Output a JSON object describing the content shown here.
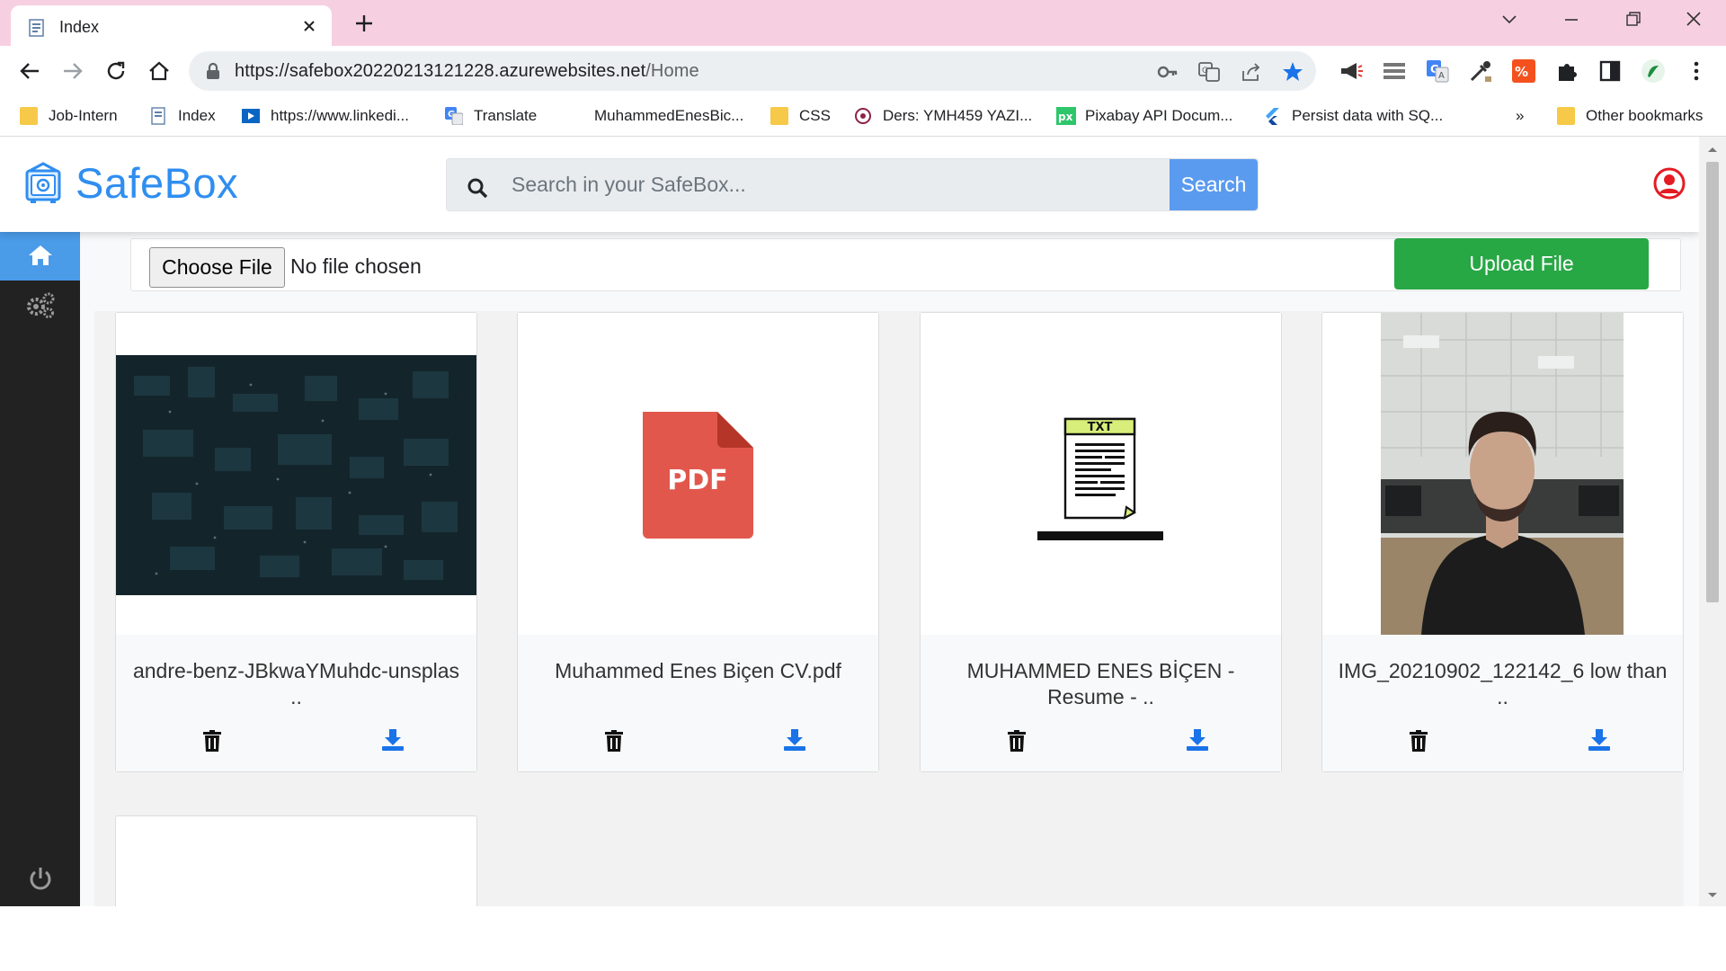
{
  "browser": {
    "tab_title": "Index",
    "url_host": "https://safebox20220213121228.azurewebsites.net",
    "url_path": "/Home",
    "bookmarks": [
      {
        "label": "Job-Intern",
        "icon": "folder-icon"
      },
      {
        "label": "Index",
        "icon": "page-icon"
      },
      {
        "label": "https://www.linkedi...",
        "icon": "linkedin-icon"
      },
      {
        "label": "Translate",
        "icon": "translate-icon"
      },
      {
        "label": "MuhammedEnesBic...",
        "icon": "github-icon"
      },
      {
        "label": "CSS",
        "icon": "folder-icon"
      },
      {
        "label": "Ders: YMH459 YAZI...",
        "icon": "course-icon"
      },
      {
        "label": "Pixabay API Docum...",
        "icon": "pixabay-icon"
      },
      {
        "label": "Persist data with SQ...",
        "icon": "flutter-icon"
      }
    ],
    "bookmarks_overflow": "»",
    "other_bookmarks": "Other bookmarks"
  },
  "app": {
    "brand": "SafeBox",
    "search_placeholder": "Search in your SafeBox...",
    "search_button": "Search",
    "choose_file": "Choose File",
    "no_file": "No file chosen",
    "upload_button": "Upload File",
    "files": [
      {
        "name": "andre-benz-JBkwaYMuhdc-unsplas ..",
        "thumb": "city-photo"
      },
      {
        "name": "Muhammed Enes Biçen CV.pdf",
        "thumb": "pdf-icon"
      },
      {
        "name": "MUHAMMED ENES BİÇEN - Resume - ..",
        "thumb": "txt-icon"
      },
      {
        "name": "IMG_20210902_122142_6 low than ..",
        "thumb": "person-photo"
      }
    ]
  },
  "colors": {
    "brand": "#2f8ef0",
    "sidebar": "#222222",
    "sidebar_active": "#4a9be8",
    "upload": "#28a745",
    "search_button": "#5b9bef",
    "tabstrip": "#f6d0e1"
  }
}
